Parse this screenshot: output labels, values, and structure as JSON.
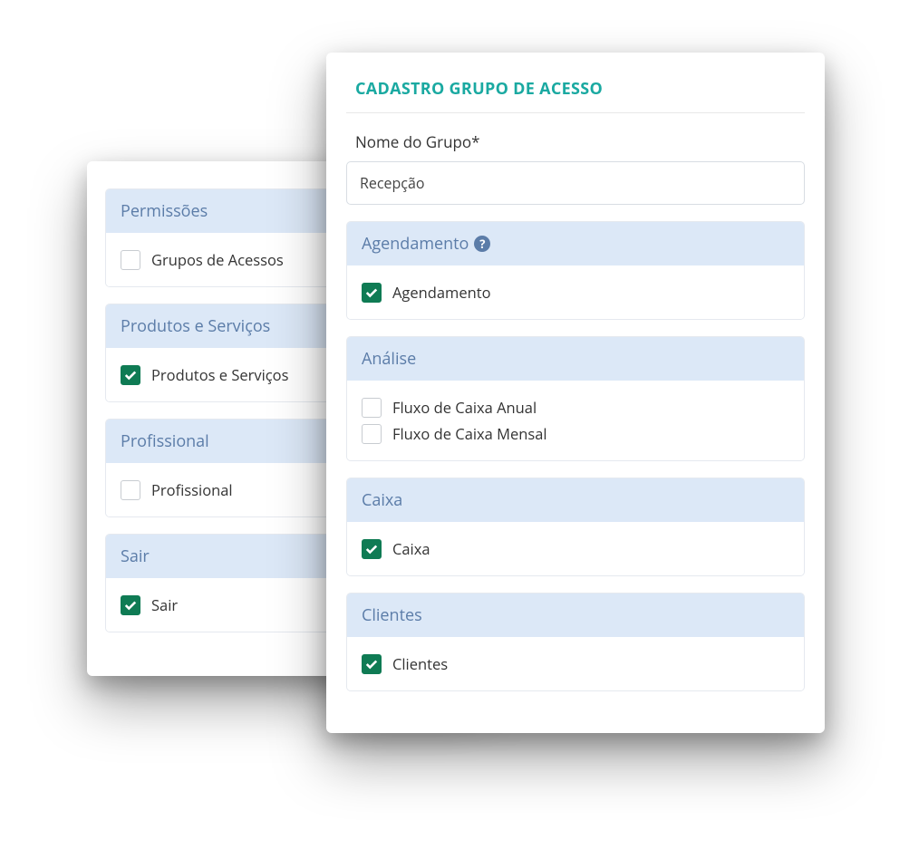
{
  "back_card": {
    "groups": [
      {
        "title": "Permissões",
        "items": [
          {
            "label": "Grupos de Acessos",
            "checked": false
          }
        ]
      },
      {
        "title": "Produtos e Serviços",
        "items": [
          {
            "label": "Produtos e Serviços",
            "checked": true
          }
        ]
      },
      {
        "title": "Profissional",
        "items": [
          {
            "label": "Profissional",
            "checked": false
          }
        ]
      },
      {
        "title": "Sair",
        "items": [
          {
            "label": "Sair",
            "checked": true
          }
        ]
      }
    ]
  },
  "front_card": {
    "title": "CADASTRO GRUPO DE ACESSO",
    "field_label": "Nome do Grupo*",
    "field_value": "Recepção",
    "groups": [
      {
        "title": "Agendamento",
        "help": true,
        "items": [
          {
            "label": "Agendamento",
            "checked": true
          }
        ]
      },
      {
        "title": "Análise",
        "help": false,
        "items": [
          {
            "label": "Fluxo de Caixa Anual",
            "checked": false
          },
          {
            "label": "Fluxo de Caixa Mensal",
            "checked": false
          }
        ]
      },
      {
        "title": "Caixa",
        "help": false,
        "items": [
          {
            "label": "Caixa",
            "checked": true
          }
        ]
      },
      {
        "title": "Clientes",
        "help": false,
        "items": [
          {
            "label": "Clientes",
            "checked": true
          }
        ]
      }
    ]
  }
}
